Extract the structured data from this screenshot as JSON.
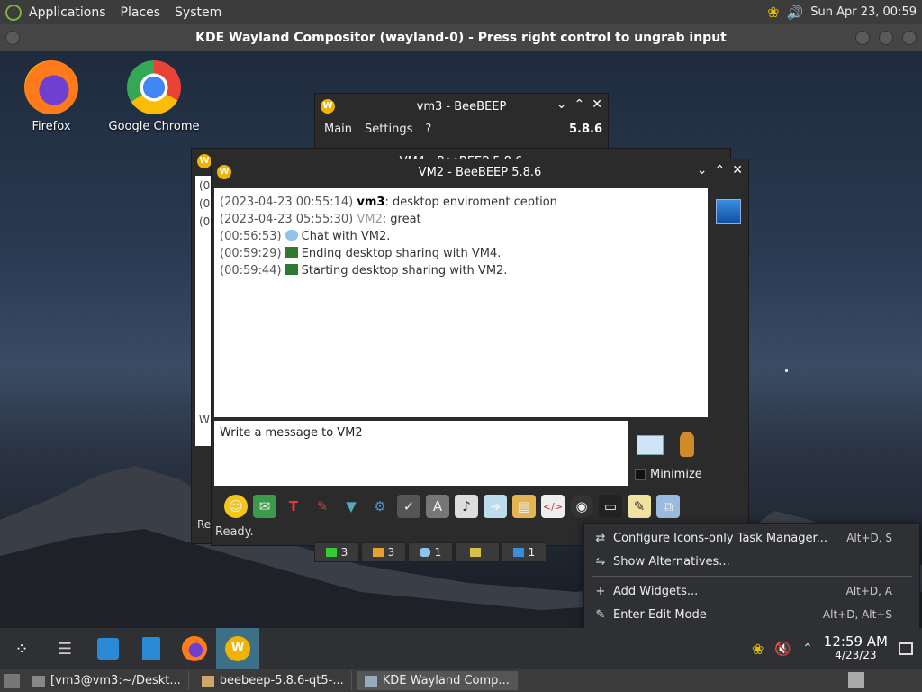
{
  "top_panel": {
    "menus": [
      "Applications",
      "Places",
      "System"
    ],
    "clock": "Sun Apr 23, 00:59"
  },
  "compositor": {
    "title": "KDE Wayland Compositor (wayland-0) - Press right control to ungrab input"
  },
  "desktop_icons": [
    {
      "label": "Firefox"
    },
    {
      "label": "Google Chrome"
    }
  ],
  "vm3_window": {
    "title": "vm3 - BeeBEEP",
    "menus": [
      "Main",
      "Settings",
      "?"
    ],
    "version": "5.8.6"
  },
  "vm4_window": {
    "title": "VM4 - BeeBEEP 5.8.6",
    "rows": [
      "(0",
      "(0",
      "(0"
    ],
    "composer_prefix": "W",
    "status_prefix": "Re"
  },
  "vm2_window": {
    "title": "VM2 - BeeBEEP 5.8.6",
    "messages": [
      {
        "ts": "(2023-04-23 00:55:14)",
        "who": "vm3",
        "text": ": desktop enviroment ception"
      },
      {
        "ts": "(2023-04-23 05:55:30)",
        "who": "VM2",
        "text": ": great"
      },
      {
        "ts": "(00:56:53)",
        "text": "Chat with VM2."
      },
      {
        "ts": "(00:59:29)",
        "text": "Ending desktop sharing with VM4."
      },
      {
        "ts": "(00:59:44)",
        "text": "Starting desktop sharing with VM2."
      }
    ],
    "composer_placeholder": "Write a message to VM2",
    "minimize_label": "Minimize",
    "status": "Ready."
  },
  "bottom_tabs": [
    {
      "count": "3"
    },
    {
      "count": "3"
    },
    {
      "count": "1"
    },
    {
      "count": ""
    },
    {
      "count": "1"
    }
  ],
  "context_menu": {
    "items": [
      {
        "label": "Configure Icons-only Task Manager...",
        "shortcut": "Alt+D, S"
      },
      {
        "label": "Show Alternatives...",
        "shortcut": ""
      },
      {
        "label": "Add Widgets...",
        "shortcut": "Alt+D, A"
      },
      {
        "label": "Enter Edit Mode",
        "shortcut": "Alt+D, Alt+S"
      }
    ]
  },
  "kde_taskbar": {
    "time": "12:59 AM",
    "date": "4/23/23"
  },
  "host_taskbar": {
    "items": [
      {
        "label": "[vm3@vm3:~/Deskt..."
      },
      {
        "label": "beebeep-5.8.6-qt5-..."
      },
      {
        "label": "KDE Wayland Comp..."
      }
    ]
  },
  "colors": {
    "accent": "#3d6f87",
    "beebeep_logo": "#f0b400"
  }
}
